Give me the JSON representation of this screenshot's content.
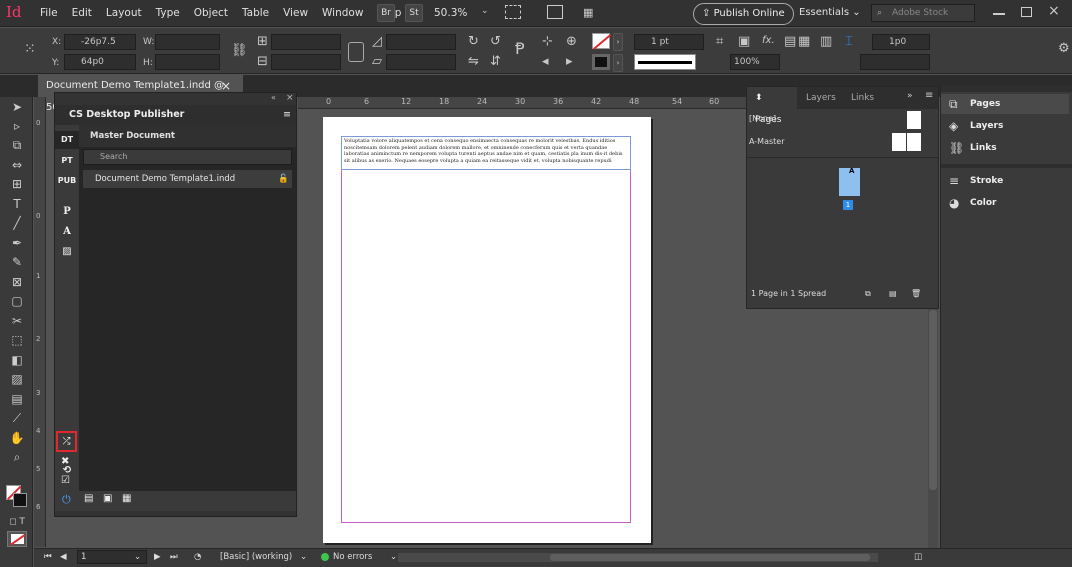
{
  "app": {
    "logo": "Id",
    "menus": [
      "File",
      "Edit",
      "Layout",
      "Type",
      "Object",
      "Table",
      "View",
      "Window",
      "Help"
    ],
    "bridge_btn": "Br",
    "stock_btn": "St",
    "zoom": "50.3%",
    "publish_btn": "Publish Online",
    "workspace": "Essentials",
    "search_placeholder": "Adobe Stock"
  },
  "control": {
    "x_label": "X:",
    "x_value": "-26p7.5",
    "y_label": "Y:",
    "y_value": "64p0",
    "w_label": "W:",
    "h_label": "H:",
    "stroke_weight": "1 pt",
    "opacity": "100%",
    "fx": "fx.",
    "gutter": "1p0"
  },
  "doc_tab": {
    "title": "Document Demo Template1.indd @ 50%",
    "close": "×"
  },
  "plugin": {
    "title": "CS Desktop Publisher",
    "side_tabs": [
      "DT",
      "PT",
      "PUB"
    ],
    "side_icons": [
      "P",
      "A"
    ],
    "section": "Master Document",
    "search_placeholder": "Search",
    "file_row": "Document Demo Template1.indd"
  },
  "rulers": {
    "h": [
      "0",
      "6",
      "12",
      "18",
      "24",
      "30",
      "36",
      "42",
      "48",
      "54",
      "60"
    ],
    "v": [
      "0",
      "0",
      "1",
      "2",
      "3",
      "4",
      "5",
      "6"
    ]
  },
  "page_text": "Voluptatia volore aliquatempos et cena consequo ensimaecta consequas re molorit velestbas. Endus iditios noscitemsam dolorem pelent audiam dolorem mallore, et omninende conecferum quis et verta quandae laboratias animinctum re nemporem volupta turenti aeptus andae nim et quam, cestiatis pla inum dis-it debis sit alibus as exerio. Nequaes eosepre volupta a quiam ea reitasseque vidit et, volupta nobisquante repudi",
  "pages_panel": {
    "tabs": [
      "Pages",
      "Layers",
      "Links"
    ],
    "rows": [
      "[None]",
      "A-Master"
    ],
    "page_label": "A",
    "page_number": "1",
    "status": "1 Page in 1 Spread"
  },
  "dock": {
    "items": [
      "Pages",
      "Layers",
      "Links",
      "Stroke",
      "Color"
    ]
  },
  "status": {
    "page": "1",
    "style": "[Basic] (working)",
    "errors": "No errors"
  },
  "colors": {
    "accent_red": "#e0282f",
    "margin_magenta": "#c45dc8",
    "page_thumb": "#8ec0ef",
    "ok_green": "#3ec44f"
  }
}
